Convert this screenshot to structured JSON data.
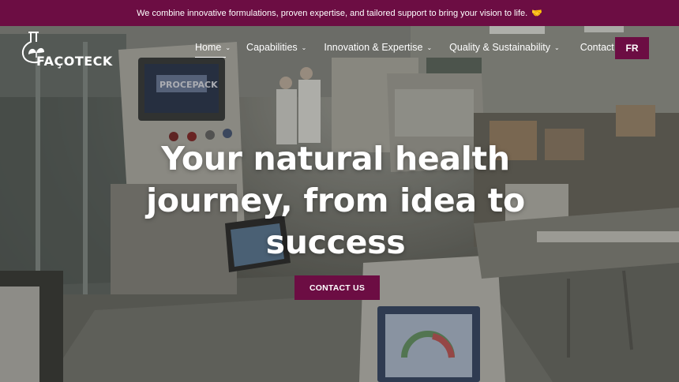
{
  "announcement": {
    "text": "We combine innovative formulations, proven expertise, and tailored support to bring your vision to life.",
    "emoji": "🤝"
  },
  "brand": {
    "name": "FAÇOTECK",
    "accent_color": "#6c0d43"
  },
  "nav": {
    "items": [
      {
        "label": "Home",
        "has_dropdown": true,
        "active": true
      },
      {
        "label": "Capabilities",
        "has_dropdown": true
      },
      {
        "label": "Innovation & Expertise",
        "has_dropdown": true
      },
      {
        "label": "Quality & Sustainability",
        "has_dropdown": true
      },
      {
        "label": "Contact",
        "has_dropdown": false
      }
    ],
    "language_button": "FR"
  },
  "hero": {
    "headline": "Your natural health journey, from idea to success",
    "cta_label": "CONTACT US",
    "background_signage": "PROCEPACK"
  }
}
